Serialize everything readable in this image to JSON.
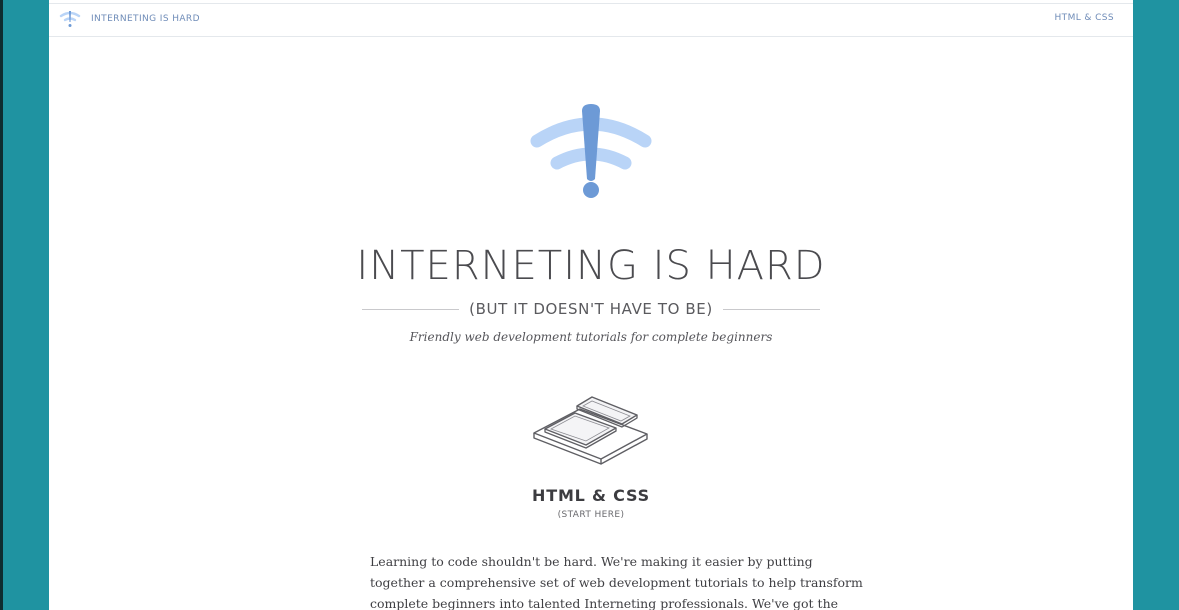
{
  "header": {
    "logo_text": "INTERNETING IS HARD",
    "nav_link": "HTML & CSS"
  },
  "hero": {
    "title": "INTERNETING IS HARD",
    "subtitle": "(BUT IT DOESN'T HAVE TO BE)",
    "tagline": "Friendly web development tutorials for complete beginners"
  },
  "card": {
    "icon": "stacked-devices-icon",
    "title": "HTML & CSS",
    "subtitle": "(START HERE)"
  },
  "intro": {
    "lines": [
      "Learning to code shouldn't be hard. We're making it easier by putting",
      "together a comprehensive set of web development tutorials to help transform",
      "complete beginners into talented Interneting professionals. We've got the"
    ]
  },
  "colors": {
    "frame": "#1f93a1",
    "accent_blue": "#6f8cb8",
    "logo_light_blue": "#b9d4f7",
    "logo_dark_blue": "#6d9ad6"
  }
}
